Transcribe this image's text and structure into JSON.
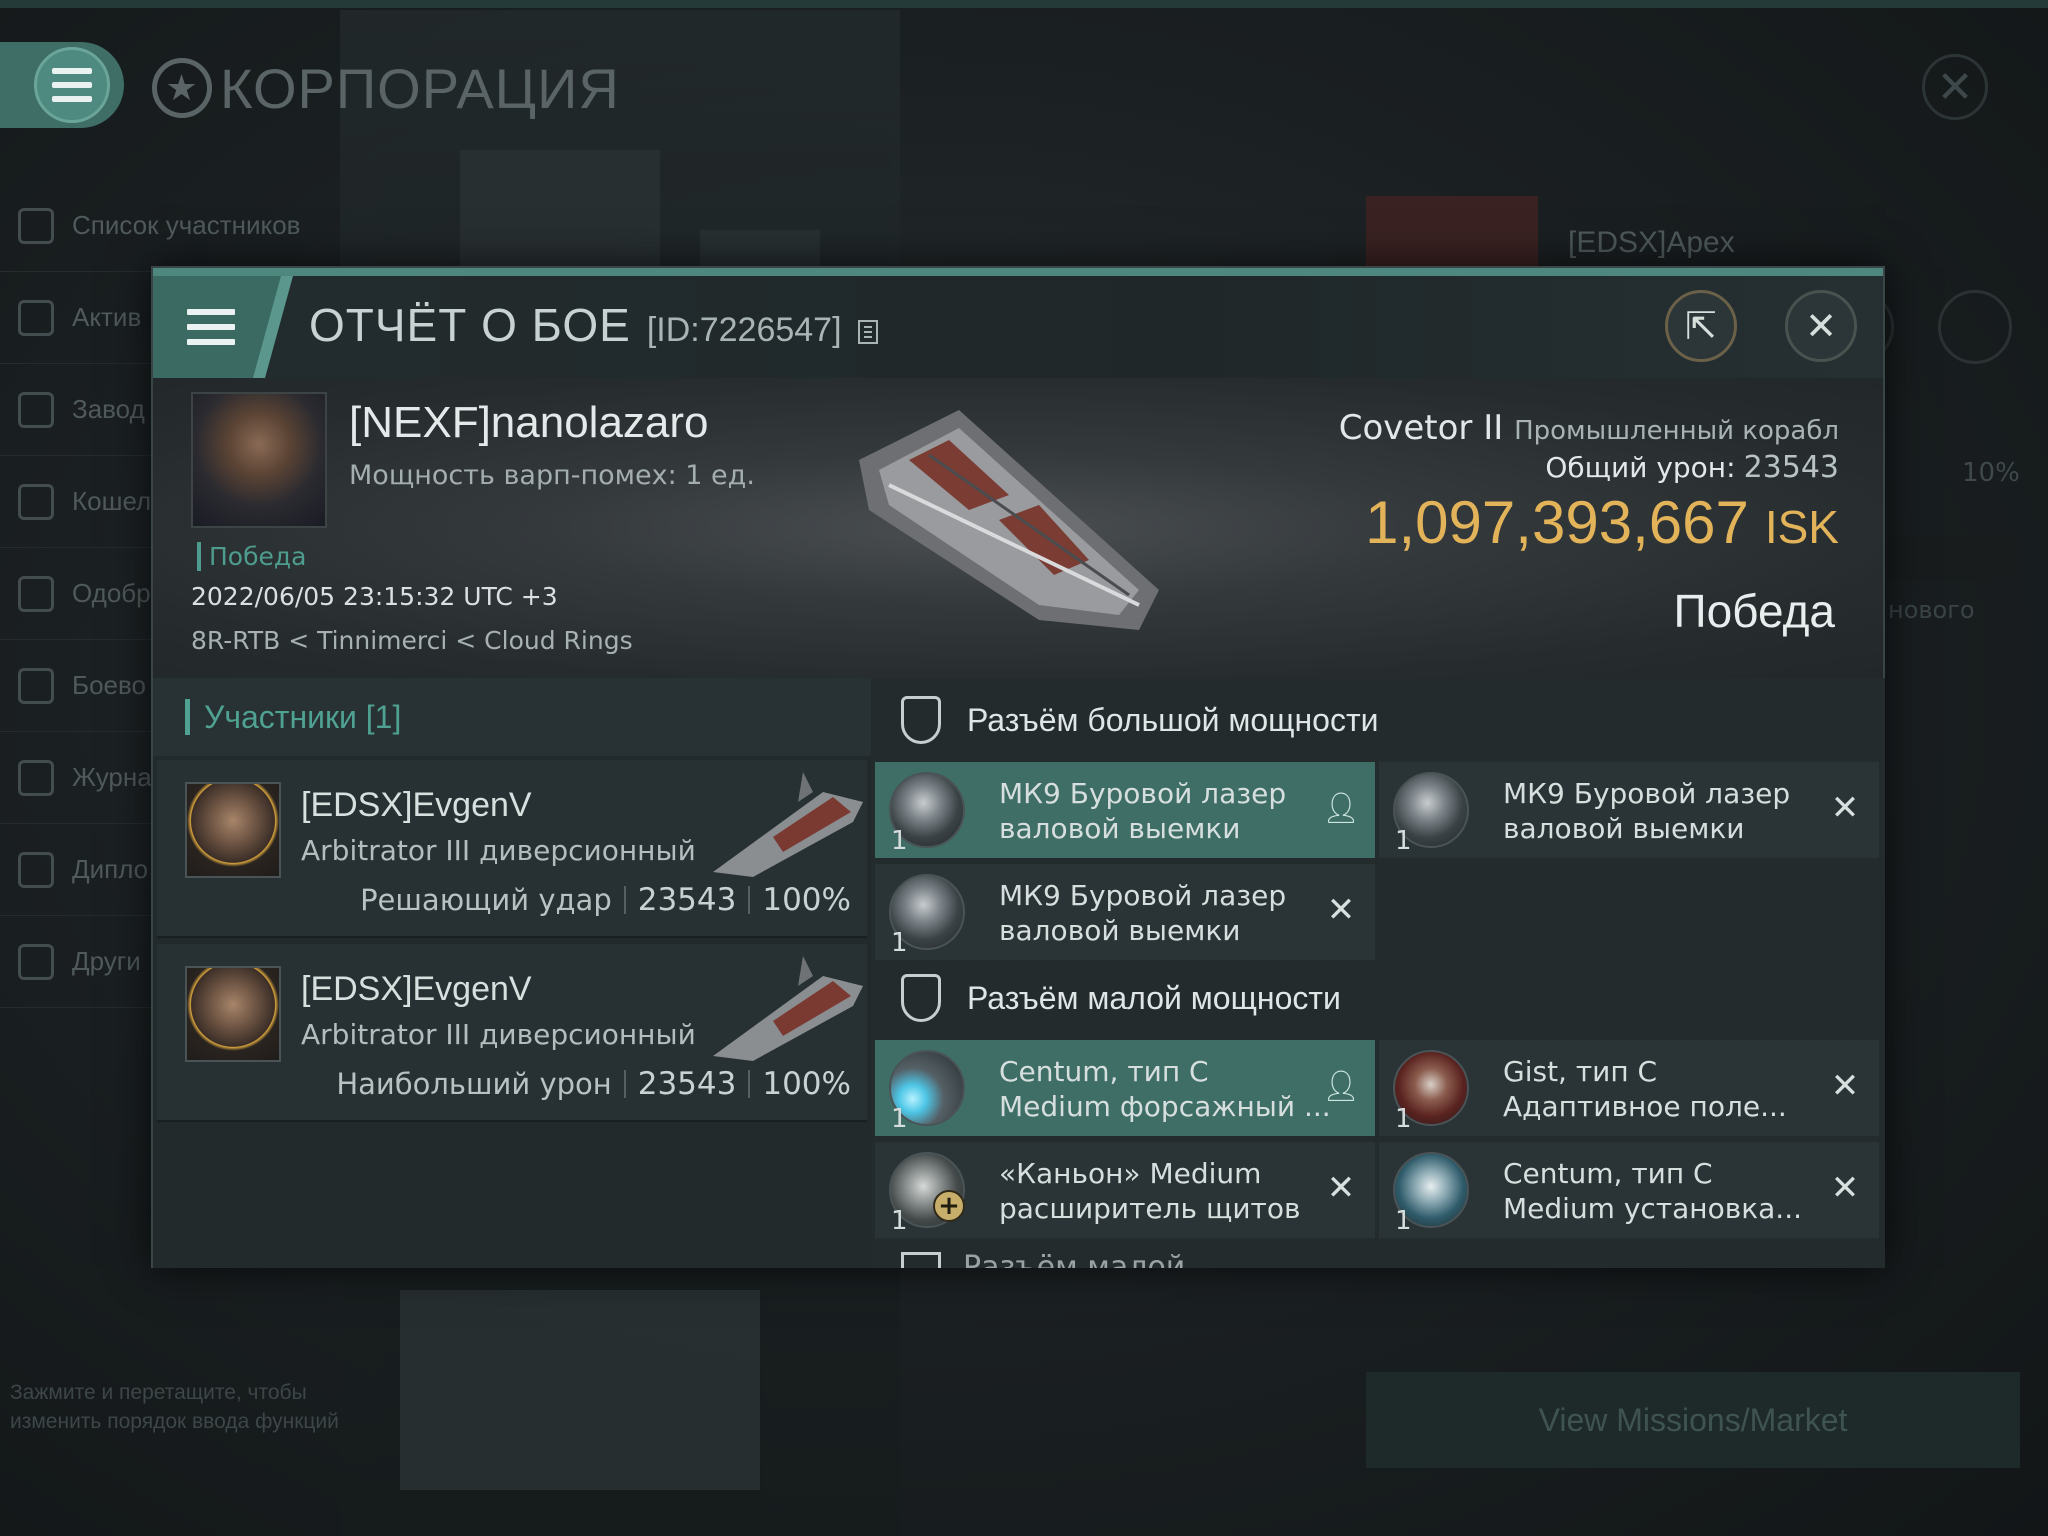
{
  "background": {
    "title": "КОРПОРАЦИЯ",
    "sidebar": [
      {
        "label": "Список участников",
        "icon": "members-icon"
      },
      {
        "label": "Актив",
        "icon": "assets-icon"
      },
      {
        "label": "Завод",
        "icon": "factory-icon"
      },
      {
        "label": "Кошел корпо",
        "icon": "wallet-icon"
      },
      {
        "label": "Одобр на при",
        "icon": "approval-icon"
      },
      {
        "label": "Боево",
        "icon": "combat-icon"
      },
      {
        "label": "Журна",
        "icon": "journal-icon"
      },
      {
        "label": "Дипло",
        "icon": "diplomacy-icon"
      },
      {
        "label": "Други",
        "icon": "other-icon"
      }
    ],
    "hint": "Зажмите и перетащите, чтобы изменить порядок ввода функций",
    "card_name": "[EDSX]Apex",
    "percent": "10%",
    "new_text": "нового",
    "market_button": "View Missions/Market"
  },
  "report": {
    "title": "ОТЧЁТ О БОЕ",
    "id": "[ID:7226547]",
    "victim": {
      "name": "[NEXF]nanolazaro",
      "warp": "Мощность варп-помех: 1 ед.",
      "status": "Победа",
      "time": "2022/06/05 23:15:32 UTC +3",
      "location": "8R-RTB < Tinnimerci < Cloud Rings",
      "ship": "Covetor II",
      "ship_class": "Промышленный корабл",
      "damage_label": "Общий урон:",
      "damage_value": "23543",
      "isk_value": "1,097,393,667",
      "isk_unit": "ISK",
      "result": "Победа"
    },
    "participants": {
      "header": "Участники [1]",
      "rows": [
        {
          "name": "[EDSX]EvgenV",
          "ship": "Arbitrator III диверсионный",
          "role": "Решающий удар",
          "damage": "23543",
          "percent": "100%"
        },
        {
          "name": "[EDSX]EvgenV",
          "ship": "Arbitrator III диверсионный",
          "role": "Наибольший урон",
          "damage": "23543",
          "percent": "100%"
        }
      ]
    },
    "high_slots": {
      "header": "Разъём большой мощности",
      "items": [
        {
          "line1": "МК9 Буровой лазер",
          "line2": "валовой выемки",
          "qty": "1",
          "status": "dropped"
        },
        {
          "line1": "МК9 Буровой лазер",
          "line2": "валовой выемки",
          "qty": "1",
          "status": "destroyed"
        },
        {
          "line1": "МК9 Буровой лазер",
          "line2": "валовой выемки",
          "qty": "1",
          "status": "destroyed"
        }
      ]
    },
    "mid_slots": {
      "header": "Разъём малой мощности",
      "items": [
        {
          "line1": "Centum, тип C",
          "line2": "Medium форсажный ...",
          "qty": "1",
          "status": "dropped"
        },
        {
          "line1": "Gist, тип C",
          "line2": "Адаптивное поле...",
          "qty": "1",
          "status": "destroyed"
        },
        {
          "line1": "«Каньон» Medium",
          "line2": "расширитель щитов",
          "qty": "1",
          "status": "destroyed"
        },
        {
          "line1": "Centum, тип C",
          "line2": "Medium установка...",
          "qty": "1",
          "status": "destroyed"
        }
      ]
    },
    "next_section_partial": "Разъём малой"
  }
}
